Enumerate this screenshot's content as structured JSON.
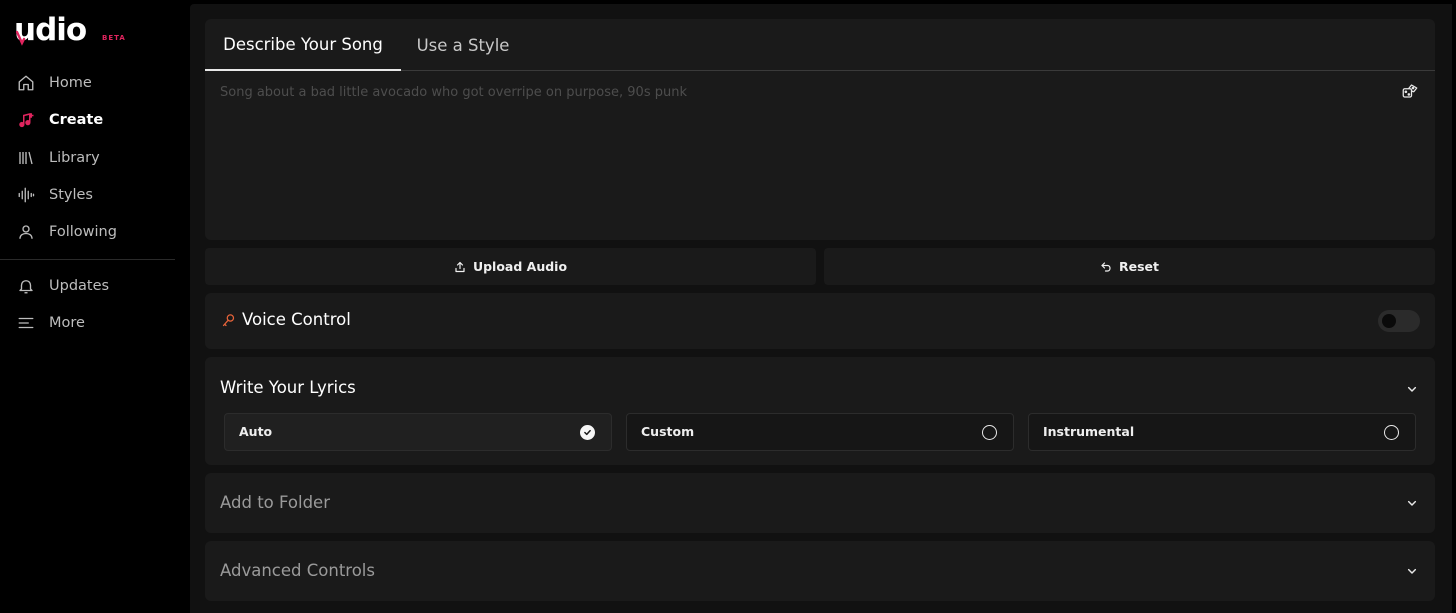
{
  "brand": {
    "name": "udio",
    "badge": "BETA",
    "accent": "#e0245e"
  },
  "sidebar": {
    "items": [
      {
        "id": "home",
        "label": "Home",
        "icon": "home-icon",
        "active": false
      },
      {
        "id": "create",
        "label": "Create",
        "icon": "music-plus-icon",
        "active": true
      },
      {
        "id": "library",
        "label": "Library",
        "icon": "library-icon",
        "active": false
      },
      {
        "id": "styles",
        "label": "Styles",
        "icon": "waveform-icon",
        "active": false
      },
      {
        "id": "following",
        "label": "Following",
        "icon": "user-icon",
        "active": false
      }
    ],
    "secondary": [
      {
        "id": "updates",
        "label": "Updates",
        "icon": "bell-icon"
      },
      {
        "id": "more",
        "label": "More",
        "icon": "menu-icon"
      }
    ]
  },
  "tabs": {
    "describe": "Describe Your Song",
    "style": "Use a Style",
    "active": "describe"
  },
  "prompt": {
    "value": "",
    "placeholder": "Song about a bad little avocado who got overripe on purpose, 90s punk"
  },
  "actions": {
    "upload": "Upload Audio",
    "reset": "Reset"
  },
  "voice": {
    "title": "Voice Control",
    "enabled": false
  },
  "lyrics": {
    "title": "Write Your Lyrics",
    "options": [
      {
        "label": "Auto",
        "selected": true
      },
      {
        "label": "Custom",
        "selected": false
      },
      {
        "label": "Instrumental",
        "selected": false
      }
    ]
  },
  "folder": {
    "title": "Add to Folder"
  },
  "advanced": {
    "title": "Advanced Controls"
  }
}
